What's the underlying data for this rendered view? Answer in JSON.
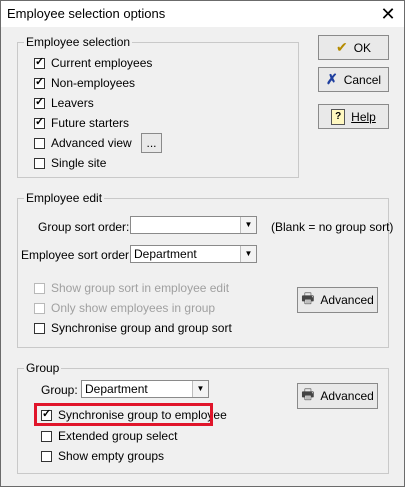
{
  "window": {
    "title": "Employee selection options"
  },
  "buttons": {
    "ok": "OK",
    "cancel": "Cancel",
    "help": "Help",
    "ellipsis": "...",
    "advanced_edit": "Advanced",
    "advanced_group": "Advanced"
  },
  "employee_selection": {
    "label": "Employee selection",
    "items": [
      {
        "label": "Current employees",
        "checked": true
      },
      {
        "label": "Non-employees",
        "checked": true
      },
      {
        "label": "Leavers",
        "checked": true
      },
      {
        "label": "Future starters",
        "checked": true
      },
      {
        "label": "Advanced view",
        "checked": false
      },
      {
        "label": "Single site",
        "checked": false
      }
    ]
  },
  "employee_edit": {
    "label": "Employee edit",
    "group_sort_label": "Group sort order:",
    "group_sort_value": "",
    "blank_note": "(Blank = no group sort)",
    "employee_sort_label": "Employee sort order:",
    "employee_sort_value": "Department",
    "options": [
      {
        "label": "Show group sort in employee edit",
        "checked": false,
        "disabled": true
      },
      {
        "label": "Only show employees in group",
        "checked": false,
        "disabled": true
      },
      {
        "label": "Synchronise group and group sort",
        "checked": false,
        "disabled": false
      }
    ]
  },
  "group": {
    "label": "Group",
    "group_label": "Group:",
    "group_value": "Department",
    "options": [
      {
        "label": "Synchronise group to employee",
        "checked": true
      },
      {
        "label": "Extended group select",
        "checked": false
      },
      {
        "label": "Show empty groups",
        "checked": false
      }
    ]
  },
  "colors": {
    "highlight": "#e0152a"
  }
}
